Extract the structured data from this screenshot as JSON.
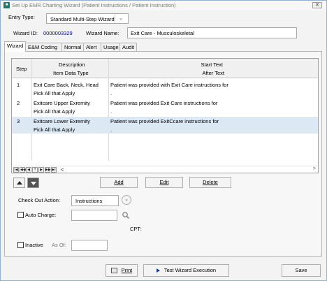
{
  "window": {
    "title": "Set Up EMR Charting Wizard (Patient Instructions / Patient Instruction)",
    "close_label": "✕"
  },
  "header": {
    "entry_type_label": "Entry Type:",
    "entry_type_value": "Standard Multi-Step Wizard",
    "wizard_id_label": "Wizard ID:",
    "wizard_id_value": "0000003329",
    "wizard_name_label": "Wizard Name:",
    "wizard_name_value": "Exit Care - Musculoskeletal"
  },
  "tabs": [
    "Wizard",
    "E&M Coding",
    "Normal",
    "Alert",
    "Usage",
    "Audit"
  ],
  "grid": {
    "columns": {
      "step": "Step",
      "description": "Description",
      "item_data_type": "Item Data Type",
      "start_text": "Start Text",
      "after_text": "After Text"
    },
    "rows": [
      {
        "step": "1",
        "description": "Exit Care Back, Neck, Head",
        "text": "Patient was provided with Exit Care instructions for",
        "sub_description": "Pick All that Apply",
        "sub_text": ".",
        "selected": false
      },
      {
        "step": "2",
        "description": "Exitcare Upper Exremity",
        "text": "Patient was provided Exit Care instructions for",
        "sub_description": "Pick All that Apply",
        "sub_text": ".",
        "selected": false
      },
      {
        "step": "3",
        "description": "Exitcare Lower Exremity",
        "text": "Patient was provided ExitCcare instructions for",
        "sub_description": "Pick All that Apply",
        "sub_text": ".",
        "selected": true
      }
    ],
    "nav_buttons": [
      "|◀",
      "◀◀",
      "◀",
      "?",
      "▶",
      "▶▶",
      "▶|"
    ],
    "scroll_left": "<",
    "scroll_right": ">"
  },
  "actions": {
    "add": "Add",
    "edit": "Edit",
    "delete": "Delete"
  },
  "checkout": {
    "label": "Check Out Action:",
    "value": "Instructions"
  },
  "auto_charge": {
    "label": "Auto Charge:",
    "cpt_label": "CPT:"
  },
  "inactive": {
    "label": "Inactive",
    "as_of_label": "As Of:"
  },
  "footer": {
    "print": "Print",
    "test": "Test Wizard Execution",
    "save": "Save"
  },
  "colors": {
    "selected_row": "#dce8f3",
    "wizard_id": "#0000a0"
  }
}
